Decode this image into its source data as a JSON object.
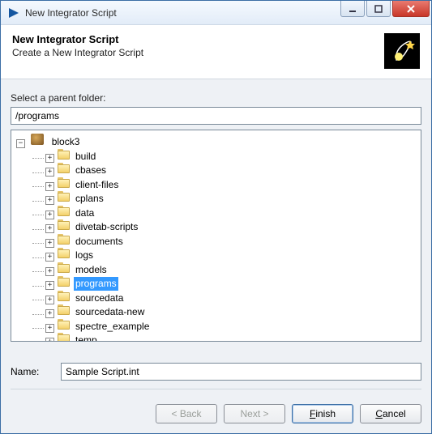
{
  "window": {
    "title": "New Integrator Script"
  },
  "header": {
    "title": "New Integrator Script",
    "subtitle": "Create a New Integrator Script"
  },
  "parentFolder": {
    "label": "Select a parent folder:",
    "value": "/programs"
  },
  "tree": {
    "root": "block3",
    "children": [
      "build",
      "cbases",
      "client-files",
      "cplans",
      "data",
      "divetab-scripts",
      "documents",
      "logs",
      "models",
      "programs",
      "sourcedata",
      "sourcedata-new",
      "spectre_example",
      "temp"
    ],
    "selected": "programs"
  },
  "nameField": {
    "label": "Name:",
    "value": "Sample Script.int"
  },
  "buttons": {
    "back": "< Back",
    "next": "Next >",
    "finish": "Finish",
    "cancel": "Cancel"
  },
  "colors": {
    "selection": "#3399ff",
    "chrome": "#e2ecf8"
  }
}
